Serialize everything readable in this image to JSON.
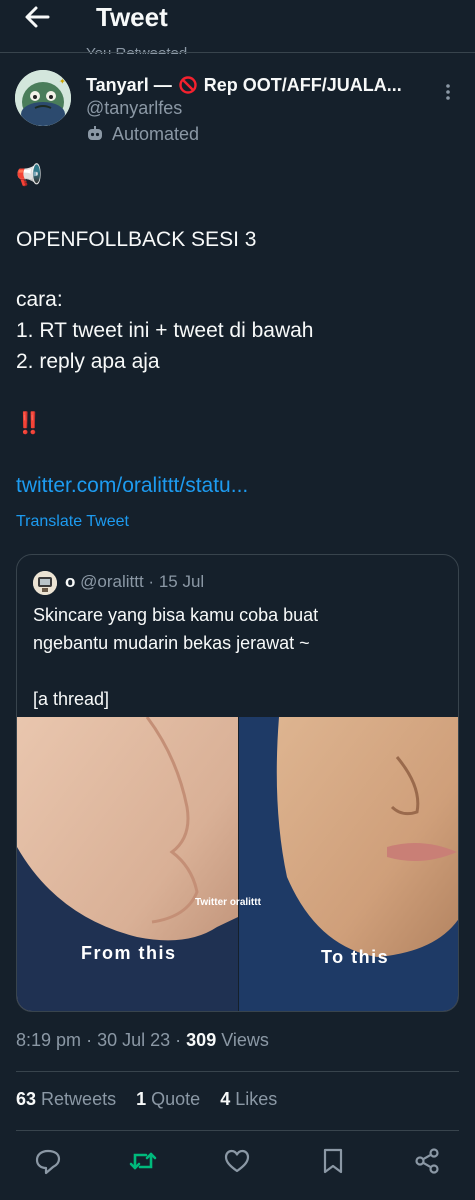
{
  "header": {
    "title": "Tweet"
  },
  "retweet_notice": "You Retweeted",
  "author": {
    "name_prefix": "Tanyarl —",
    "name_suffix": "Rep OOT/AFF/JUALA...",
    "handle": "@tanyarlfes",
    "automated_label": "Automated"
  },
  "tweet": {
    "emoji_megaphone": "📢",
    "line_title": "OPENFOLLBACK SESI 3",
    "line_cara": "cara:",
    "line_step1": "1. RT tweet ini + tweet di bawah",
    "line_step2": "2. reply apa aja",
    "emoji_bang": "‼️",
    "link": "twitter.com/oralittt/statu...",
    "translate_label": "Translate Tweet"
  },
  "quote": {
    "name": "o",
    "handle": "@oralittt",
    "date": "15 Jul",
    "text_line1": "Skincare yang bisa kamu coba buat",
    "text_line2": "ngebantu mudarin bekas jerawat ~",
    "text_line3": "[a thread]",
    "image_watermark": "Twitter oralittt",
    "image_label_left": "From this",
    "image_label_right": "To this"
  },
  "meta": {
    "time": "8:19 pm",
    "date": "30 Jul 23",
    "views_count": "309",
    "views_label": "Views"
  },
  "stats": {
    "retweets_count": "63",
    "retweets_label": "Retweets",
    "quotes_count": "1",
    "quotes_label": "Quote",
    "likes_count": "4",
    "likes_label": "Likes"
  },
  "colors": {
    "background": "#15202b",
    "accent": "#1d9bf0",
    "retweet_active": "#00ba7c",
    "secondary_text": "#8b98a5"
  },
  "icons": [
    "back-arrow-icon",
    "no-entry-icon",
    "more-icon",
    "bot-icon",
    "reply-icon",
    "retweet-icon",
    "like-icon",
    "bookmark-icon",
    "share-icon"
  ]
}
